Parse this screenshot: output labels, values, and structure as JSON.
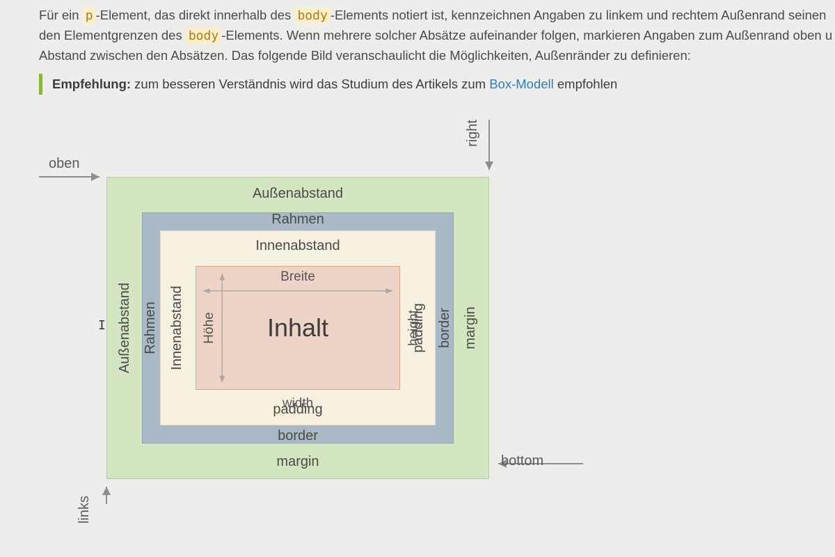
{
  "paragraph": {
    "pre1": "Für ein ",
    "code1": "p",
    "mid1": "-Element, das direkt innerhalb des ",
    "code2": "body",
    "mid2": "-Elements notiert ist, kennzeichnen Angaben zu linkem und rechtem Außenrand seinen den Elementgrenzen des ",
    "code3": "body",
    "mid3": "-Elements. Wenn mehrere solcher Absätze aufeinander folgen, markieren Angaben zum Außenrand oben u  Abstand zwischen den Absätzen. Das folgende Bild veranschaulicht die Möglichkeiten, Außenränder zu definieren:"
  },
  "callout": {
    "strong": "Empfehlung:",
    "pre": " zum besseren Verständnis wird das Studium des Artikels zum ",
    "link": "Box-Modell",
    "post": " empfohlen"
  },
  "arrows": {
    "top": "oben",
    "right": "right",
    "bottom": "bottom",
    "left": "links"
  },
  "box": {
    "margin": {
      "top": "Außenabstand",
      "left": "Außenabstand",
      "right": "margin",
      "bottom": "margin"
    },
    "border": {
      "top": "Rahmen",
      "left": "Rahmen",
      "right": "border",
      "bottom": "border"
    },
    "padding": {
      "top": "Innenabstand",
      "left": "Innenabstand",
      "right": "padding",
      "bottom": "padding"
    },
    "content": {
      "center": "Inhalt",
      "widthTop": "Breite",
      "widthBottom": "width",
      "heightLeft": "Höhe",
      "heightRight": "height"
    }
  }
}
